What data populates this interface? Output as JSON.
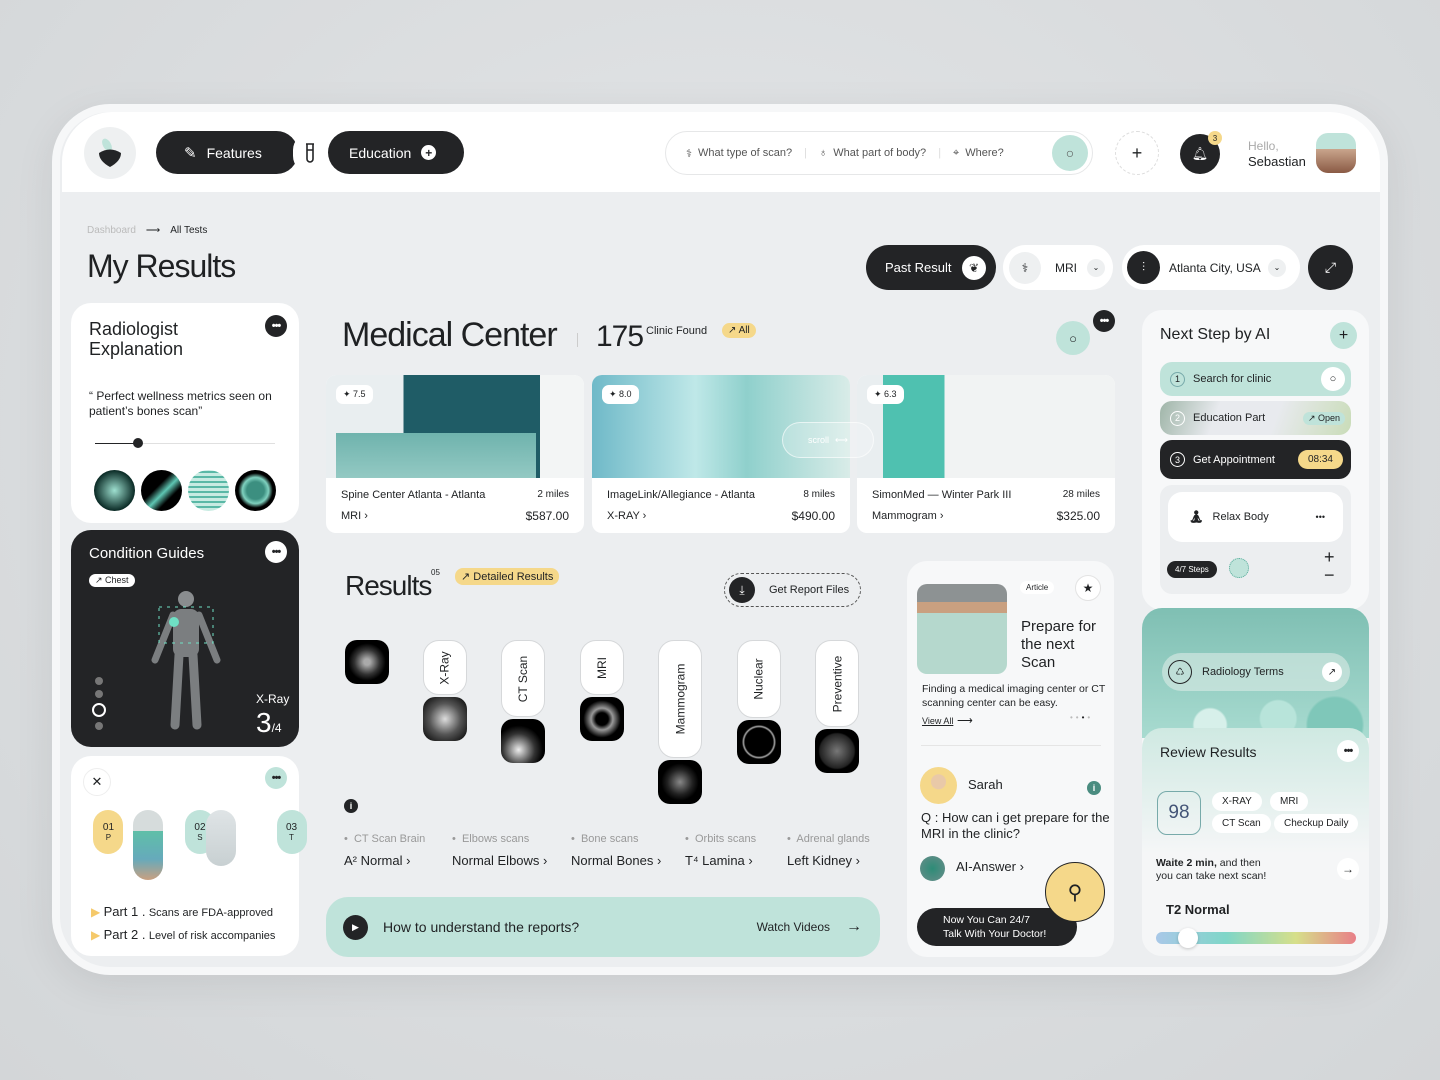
{
  "nav": {
    "features": "Features",
    "education": "Education"
  },
  "search": {
    "scan_type": "What type of scan?",
    "body_part": "What part of body?",
    "where": "Where?"
  },
  "user": {
    "greeting": "Hello,",
    "name": "Sebastian",
    "notifications": "3"
  },
  "breadcrumb": {
    "parent": "Dashboard",
    "current": "All Tests"
  },
  "page_title": "My Results",
  "filters": {
    "past_result": "Past Result",
    "scan": "MRI",
    "location": "Atlanta City, USA"
  },
  "radiologist": {
    "title_1": "Radiologist",
    "title_2": "Explanation",
    "quote": "“ Perfect wellness metrics seen on patient’s bones scan”",
    "progress": 0.24
  },
  "condition": {
    "title": "Condition Guides",
    "tag": "↗ Chest",
    "type": "X-Ray",
    "current": "3",
    "total": "/4"
  },
  "steps_card": {
    "steps": [
      {
        "num": "01",
        "letter": "P"
      },
      {
        "num": "02",
        "letter": "S"
      },
      {
        "num": "03",
        "letter": "T"
      }
    ],
    "parts": [
      {
        "label": "Part 1 .",
        "text": "Scans are FDA-approved"
      },
      {
        "label": "Part 2 .",
        "text": "Level of risk accompanies"
      }
    ]
  },
  "medical": {
    "title": "Medical Center",
    "count": "175",
    "count_label": "Clinic Found",
    "all": "↗ All",
    "scroll": "scroll",
    "clinics": [
      {
        "rating": "7.5",
        "name": "Spine Center Atlanta - Atlanta",
        "distance": "2 miles",
        "type": "MRI ›",
        "price": "$587.00"
      },
      {
        "rating": "8.0",
        "name": "ImageLink/Allegiance - Atlanta",
        "distance": "8 miles",
        "type": "X-RAY ›",
        "price": "$490.00"
      },
      {
        "rating": "6.3",
        "name": "SimonMed — Winter Park III",
        "distance": "28 miles",
        "type": "Mammogram ›",
        "price": "$325.00"
      }
    ]
  },
  "results": {
    "title": "Results",
    "count": "05",
    "detailed": "↗ Detailed Results",
    "report": "Get Report Files",
    "categories": [
      "X-Ray",
      "CT Scan",
      "MRI",
      "Mammogram",
      "Nuclear",
      "Preventive"
    ],
    "findings": [
      {
        "label": "CT Scan Brain",
        "value": "A² Normal ›"
      },
      {
        "label": "Elbows scans",
        "value": "Normal Elbows ›"
      },
      {
        "label": "Bone scans",
        "value": "Normal Bones ›"
      },
      {
        "label": "Orbits scans",
        "value": "T⁴ Lamina ›"
      },
      {
        "label": "Adrenal glands",
        "value": "Left Kidney ›"
      }
    ],
    "video_q": "How to understand the reports?",
    "video_btn": "Watch Videos"
  },
  "article": {
    "tag": "Article",
    "title": "Prepare for the next Scan",
    "desc": "Finding a medical imaging center or CT scanning center can be easy.",
    "view_all": "View All"
  },
  "qa": {
    "user": "Sarah",
    "question": "Q : How can i get prepare for the MRI in the clinic?",
    "answer": "AI-Answer ›",
    "doctor_1": "Now You Can 24/7",
    "doctor_2": "Talk With Your Doctor!"
  },
  "ai": {
    "title": "Next Step by AI",
    "steps": [
      {
        "num": "1",
        "label": "Search for clinic"
      },
      {
        "num": "2",
        "label": "Education Part",
        "badge": "↗ Open"
      },
      {
        "num": "3",
        "label": "Get Appointment",
        "badge": "08:34"
      }
    ],
    "relax": "Relax Body",
    "progress": "4/7 Steps"
  },
  "review": {
    "terms": "Radiology Terms",
    "title": "Review Results",
    "score": "98",
    "tags": [
      "X-RAY",
      "MRI",
      "CT Scan",
      "Checkup Daily"
    ],
    "wait_bold": "Waite 2 min,",
    "wait_rest": " and then",
    "wait_2": "you can take next scan!",
    "status": "T2 Normal",
    "level": 0.16
  },
  "colors": {
    "accent": "#bfe3da",
    "dark": "#232426",
    "yellow": "#f5d88a"
  }
}
